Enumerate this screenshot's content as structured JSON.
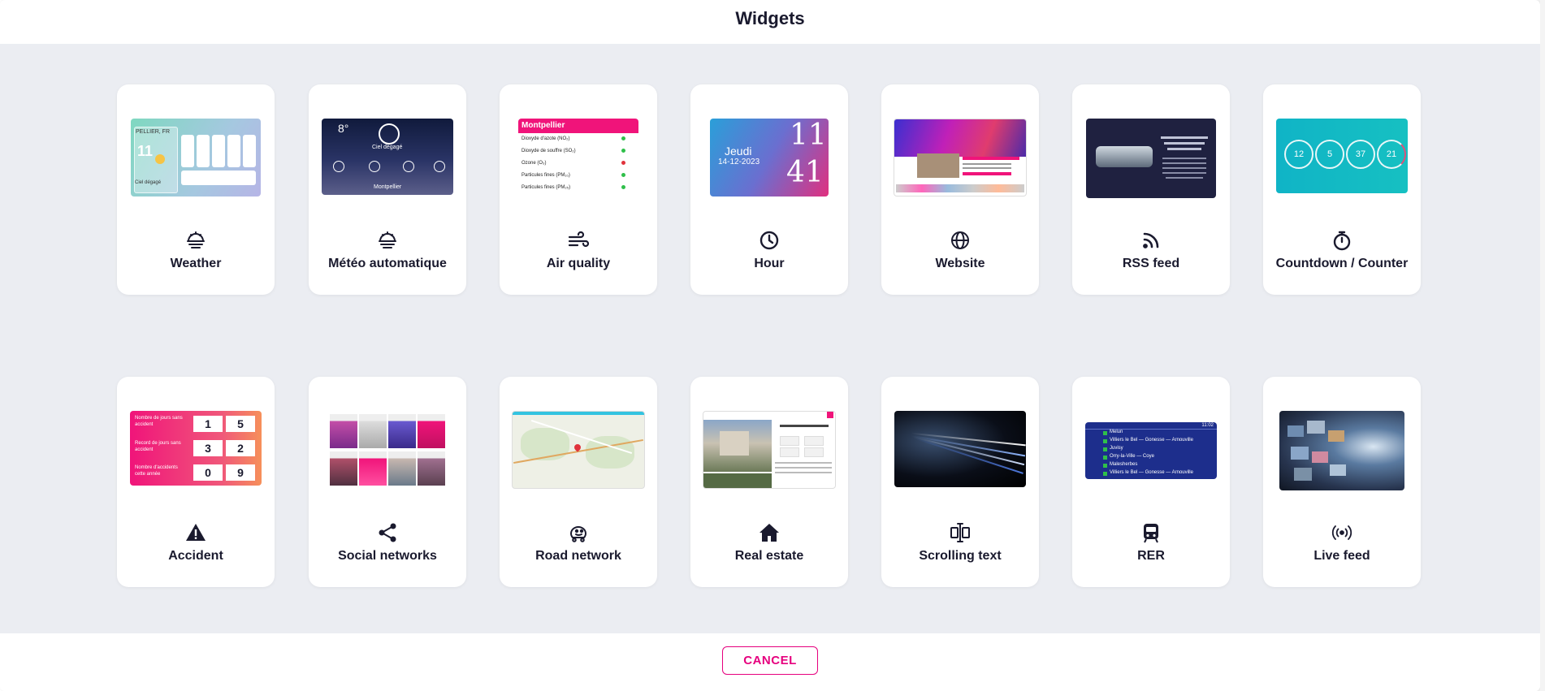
{
  "header": {
    "title": "Widgets"
  },
  "widgets": [
    {
      "label": "Weather",
      "icon": "cloud-sun-icon",
      "thumb": {
        "temp": "11",
        "city": "PELLIER, FR",
        "desc": "Ciel dégagé"
      }
    },
    {
      "label": "Météo automatique",
      "icon": "cloud-sun-icon",
      "thumb": {
        "temp": "8°",
        "desc": "Ciel dégagé",
        "city": "Montpellier"
      }
    },
    {
      "label": "Air quality",
      "icon": "wind-icon",
      "thumb": {
        "city": "Montpellier",
        "rows": [
          "Dioxyde d'azote (NO₂)",
          "Dioxyde de souffre (SO₂)",
          "Ozone (O₃)",
          "Particules fines (PM₁₀)",
          "Particules fines (PM₂₅)"
        ]
      }
    },
    {
      "label": "Hour",
      "icon": "clock-icon",
      "thumb": {
        "day": "Jeudi",
        "date": "14-12-2023",
        "hours": "11",
        "minutes": "41"
      }
    },
    {
      "label": "Website",
      "icon": "globe-icon",
      "thumb": {}
    },
    {
      "label": "RSS feed",
      "icon": "rss-icon",
      "thumb": {}
    },
    {
      "label": "Countdown / Counter",
      "icon": "stopwatch-icon",
      "thumb": {
        "values": [
          "12",
          "5",
          "37",
          "21"
        ]
      }
    },
    {
      "label": "Accident",
      "icon": "warning-icon",
      "thumb": {
        "rows": [
          {
            "text": "Nombre de jours sans accident",
            "d1": "1",
            "d2": "5"
          },
          {
            "text": "Record de jours sans accident",
            "d1": "3",
            "d2": "2"
          },
          {
            "text": "Nombre d'accidents cette année",
            "d1": "0",
            "d2": "9"
          }
        ]
      }
    },
    {
      "label": "Social networks",
      "icon": "share-icon",
      "thumb": {}
    },
    {
      "label": "Road network",
      "icon": "waze-icon",
      "thumb": {}
    },
    {
      "label": "Real estate",
      "icon": "home-icon",
      "thumb": {}
    },
    {
      "label": "Scrolling text",
      "icon": "scrolling-text-icon",
      "thumb": {}
    },
    {
      "label": "RER",
      "icon": "train-icon",
      "thumb": {
        "time": "11:02",
        "stations": [
          "Melun",
          "Villiers le Bel — Gonesse — Arnouville",
          "Juvisy",
          "Orry-la-Ville — Coye",
          "Malesherbes",
          "Villiers le Bel — Gonesse — Arnouville"
        ]
      }
    },
    {
      "label": "Live feed",
      "icon": "broadcast-icon",
      "thumb": {}
    }
  ],
  "footer": {
    "cancel_label": "CANCEL"
  },
  "colors": {
    "accent": "#e6007e",
    "text": "#1a1a2e",
    "background": "#ebedf2"
  }
}
